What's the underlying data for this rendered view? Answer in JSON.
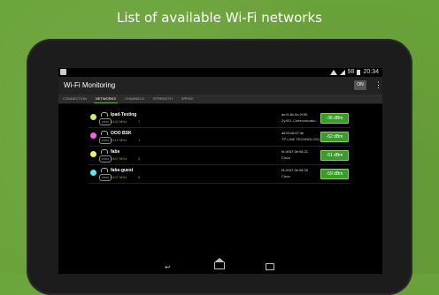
{
  "headline": "List of available Wi-Fi networks",
  "status": {
    "time": "20:34",
    "battery": "98"
  },
  "actionbar": {
    "title": "Wi-Fi Monitoring",
    "on_label": "ON",
    "menu": "⋮"
  },
  "tabs": [
    "CONNECTION",
    "NETWORKS",
    "CHANNELS",
    "STRENGTH",
    "SPEED"
  ],
  "active_tab": "NETWORKS",
  "networks": [
    {
      "ssid": "Ipad-Testing",
      "freq": "2442 MHz",
      "channel": "7",
      "mac": "ac:f1:8c:0c:2f:90",
      "vendor": "ZyXEL Communicatio...",
      "dbm": "-36 dBm",
      "dot_color": "#c8f06a",
      "encryption": "WPA2"
    },
    {
      "ssid": "OOO BSK",
      "freq": "2412 MHz",
      "channel": "1",
      "mac": "a8:f3:c6:67:3e",
      "vendor": "TP-LINK TECHNOLOGI...",
      "dbm": "-62 dBm",
      "dot_color": "#ee66dd",
      "encryption": "WPA2"
    },
    {
      "ssid": "fabs",
      "freq": "2447 MHz",
      "channel": "8",
      "mac": "f4:4f:57:3e:08:21",
      "vendor": "Cisco",
      "dbm": "-61 dBm",
      "dot_color": "#f0f06a",
      "encryption": "WPA2"
    },
    {
      "ssid": "fabs-guest",
      "freq": "2447 MHz",
      "channel": "8",
      "mac": "f4:4f:57:3e:08:20",
      "vendor": "Cisco",
      "dbm": "-59 dBm",
      "dot_color": "#6ae0e8",
      "encryption": "WPA2"
    }
  ],
  "colors": {
    "background": "#6aa33a",
    "accent": "#3a9a2a"
  }
}
